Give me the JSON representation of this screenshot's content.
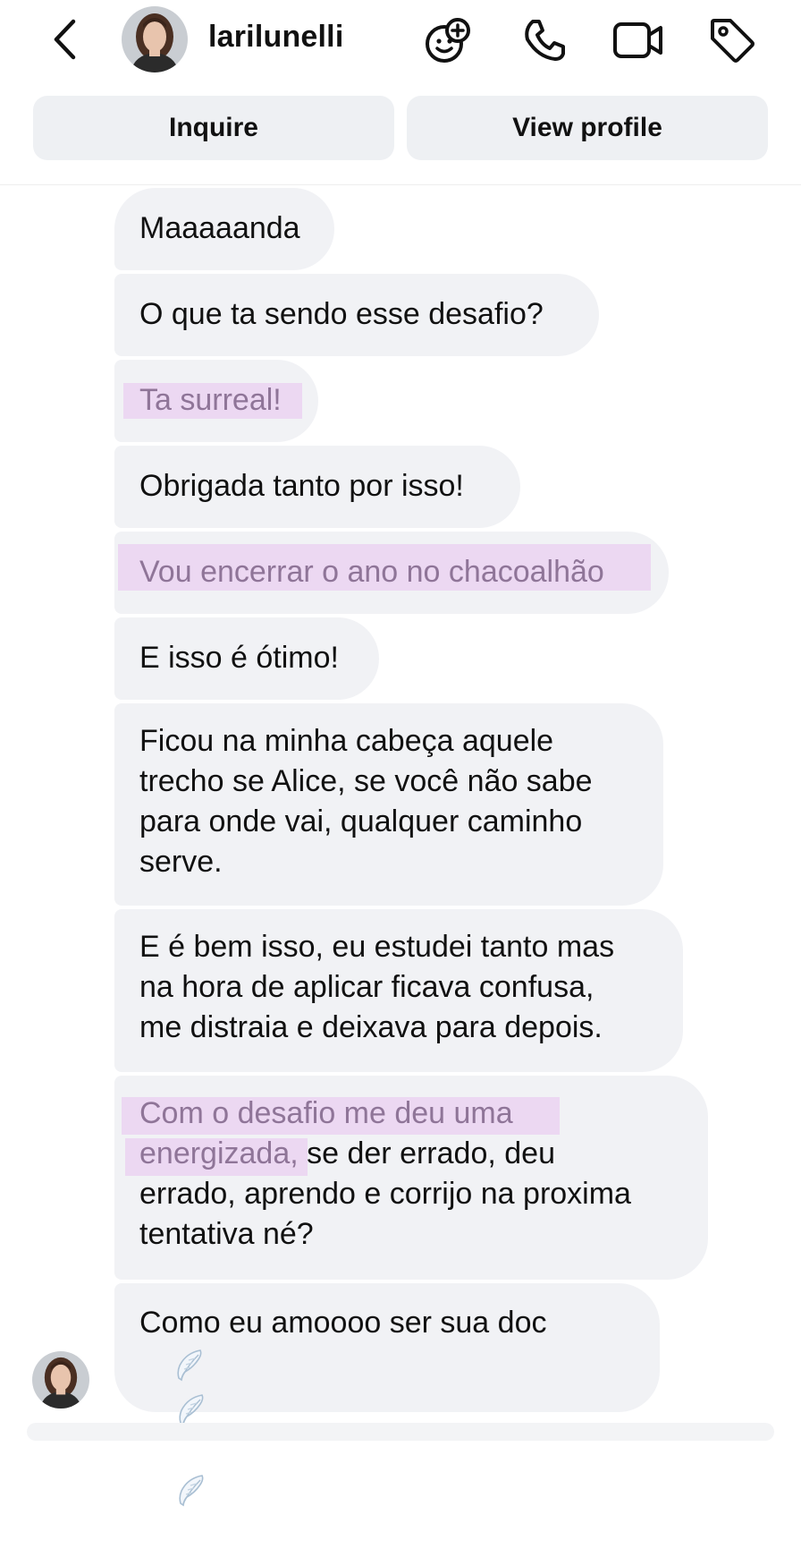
{
  "header": {
    "username": "larilunelli",
    "icons": [
      "back-chevron-icon",
      "add-reaction-icon",
      "phone-icon",
      "video-camera-icon",
      "tag-icon"
    ]
  },
  "actions": {
    "inquire_label": "Inquire",
    "view_profile_label": "View profile"
  },
  "messages": [
    {
      "lines": [
        "Maaaaanda"
      ]
    },
    {
      "lines": [
        "O que ta sendo esse desafio?"
      ]
    },
    {
      "lines": [
        "Ta surreal!"
      ],
      "highlighted": true
    },
    {
      "lines": [
        "Obrigada tanto por isso!"
      ]
    },
    {
      "lines": [
        "Vou encerrar o ano no chacoalhão"
      ],
      "highlighted": true
    },
    {
      "lines": [
        "E isso é ótimo!"
      ]
    },
    {
      "lines": [
        "Ficou na minha cabeça aquele",
        "trecho se Alice, se você não sabe",
        "para onde vai, qualquer caminho",
        "serve."
      ]
    },
    {
      "lines": [
        "E é bem isso, eu estudei tanto mas",
        "na hora de aplicar ficava confusa,",
        "me distraia e deixava para depois."
      ]
    },
    {
      "lines": [
        "Com o desafio me deu uma",
        "energizada,",
        " se der errado, deu",
        "errado, aprendo e corrijo na proxima",
        "tentativa né?"
      ],
      "highlighted_part": "Com o desafio me deu uma energizada,"
    },
    {
      "lines": [
        "Como eu amoooo ser sua doc"
      ],
      "emoji": "wing-icon"
    }
  ],
  "colors": {
    "bubble": "#f1f2f5",
    "highlight": "#ecd8f2",
    "highlight_text": "#8f7598",
    "button_bg": "#eef0f3"
  }
}
